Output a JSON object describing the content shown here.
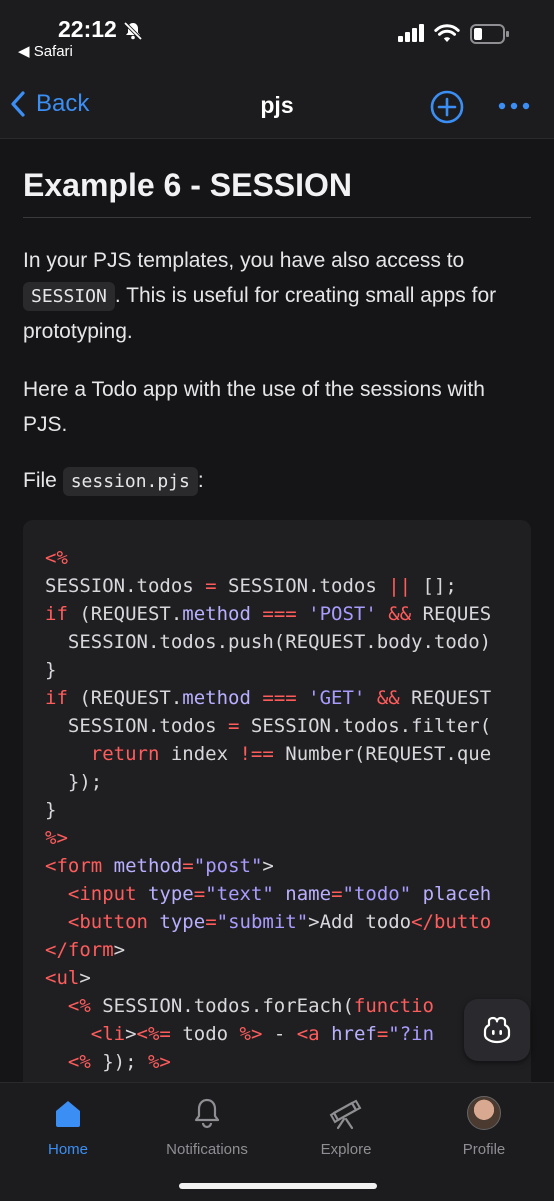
{
  "status": {
    "time": "22:12",
    "back_app": "Safari"
  },
  "nav": {
    "back_label": "Back",
    "title": "pjs"
  },
  "article": {
    "heading": "Example 6 - SESSION",
    "p1_before": "In your PJS templates, you have also access to",
    "p1_code": "SESSION",
    "p1_after": ". This is useful for creating small apps for prototyping.",
    "p2": "Here a Todo app with the use of the sessions with PJS.",
    "p3_before": "File",
    "p3_code": "session.pjs",
    "p3_after": ":"
  },
  "code_lines": [
    "<%",
    "SESSION.todos = SESSION.todos || [];",
    "if (REQUEST.method === 'POST' && REQUES",
    "  SESSION.todos.push(REQUEST.body.todo)",
    "}",
    "if (REQUEST.method === 'GET' && REQUEST",
    "  SESSION.todos = SESSION.todos.filter(",
    "    return index !== Number(REQUEST.que",
    "  });",
    "}",
    "%>",
    "<form method=\"post\">",
    "  <input type=\"text\" name=\"todo\" placeh",
    "  <button type=\"submit\">Add todo</butto",
    "</form>",
    "<ul>",
    "  <% SESSION.todos.forEach(functio",
    "    <li><%= todo %> - <a href=\"?in",
    "  <% }); %>"
  ],
  "tabs": [
    {
      "label": "Home",
      "icon": "home-icon",
      "active": true
    },
    {
      "label": "Notifications",
      "icon": "bell-icon",
      "active": false
    },
    {
      "label": "Explore",
      "icon": "telescope-icon",
      "active": false
    },
    {
      "label": "Profile",
      "icon": "avatar",
      "active": false
    }
  ],
  "colors": {
    "accent": "#3b8ef3",
    "keyword": "#ff5c5c",
    "string": "#a99cff"
  }
}
